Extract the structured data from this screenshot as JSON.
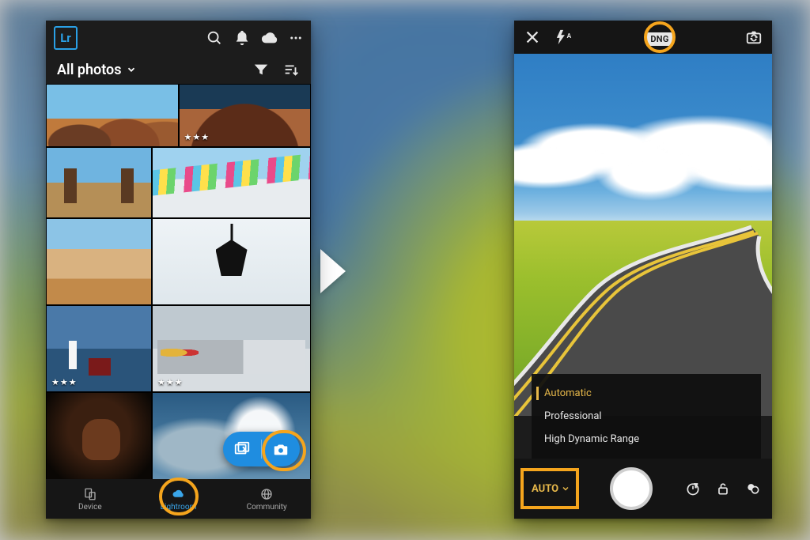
{
  "app": {
    "logo_text": "Lr"
  },
  "library": {
    "title": "All photos",
    "nav": {
      "device": "Device",
      "lightroom": "Lightroom",
      "community": "Community",
      "active": "lightroom"
    },
    "thumbs": [
      {
        "id": "rock",
        "stars": ""
      },
      {
        "id": "arch",
        "stars": "★★★"
      },
      {
        "id": "church",
        "stars": ""
      },
      {
        "id": "flags",
        "stars": ""
      },
      {
        "id": "mesa",
        "stars": ""
      },
      {
        "id": "lamp",
        "stars": ""
      },
      {
        "id": "light",
        "stars": "★★★"
      },
      {
        "id": "train",
        "stars": "★★★"
      },
      {
        "id": "horse",
        "stars": ""
      },
      {
        "id": "sky",
        "stars": ""
      }
    ]
  },
  "camera": {
    "format_badge": "DNG",
    "modes": [
      "Automatic",
      "Professional",
      "High Dynamic Range"
    ],
    "selected_mode_index": 0,
    "auto_label": "AUTO"
  }
}
